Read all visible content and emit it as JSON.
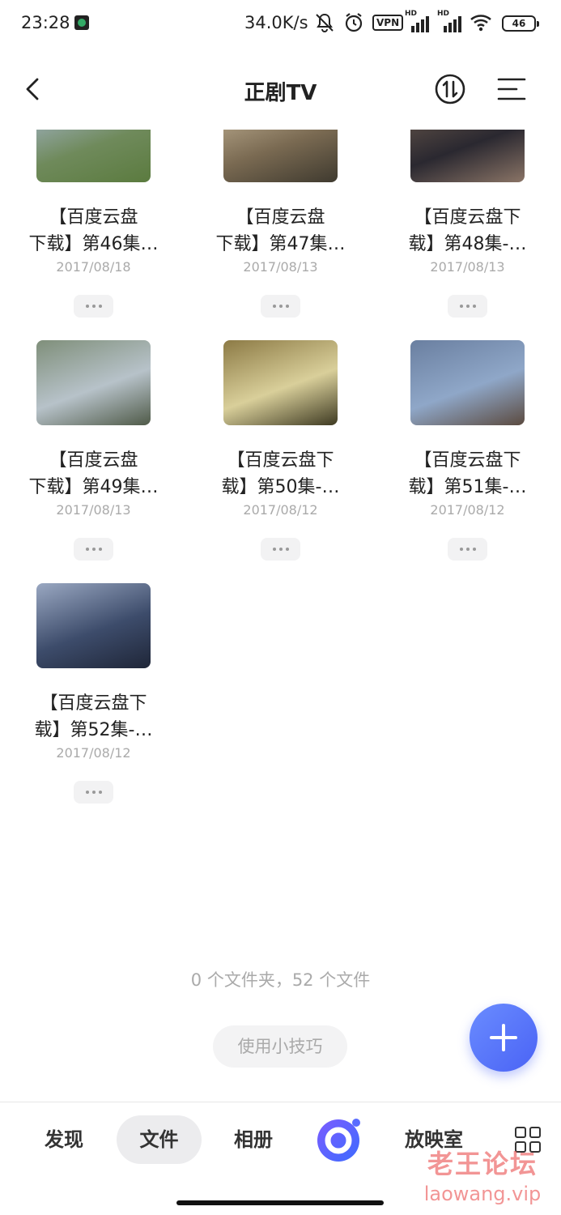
{
  "status_bar": {
    "time": "23:28",
    "net_speed": "34.0K/s",
    "vpn": "VPN",
    "hd": "HD",
    "battery": "46"
  },
  "header": {
    "title": "正剧TV",
    "back_icon": "chevron-left-icon",
    "sort_icon": "sort-icon",
    "menu_icon": "list-menu-icon"
  },
  "files": [
    {
      "line1": "【百度云盘",
      "line2": "下载】第46集…",
      "date": "2017/08/18",
      "thumb_colors": [
        "#6f8a5b",
        "#aab9d6",
        "#5b7b3f"
      ]
    },
    {
      "line1": "【百度云盘",
      "line2": "下载】第47集…",
      "date": "2017/08/13",
      "thumb_colors": [
        "#7a6a52",
        "#c7b79a",
        "#3f3a2f"
      ]
    },
    {
      "line1": "【百度云盘下",
      "line2": "载】第48集-…",
      "date": "2017/08/13",
      "thumb_colors": [
        "#2a2830",
        "#6d5b4d",
        "#8a7466"
      ]
    },
    {
      "line1": "【百度云盘",
      "line2": "下载】第49集…",
      "date": "2017/08/13",
      "thumb_colors": [
        "#b7c2c9",
        "#7f8f7a",
        "#4f5a48"
      ]
    },
    {
      "line1": "【百度云盘下",
      "line2": "载】第50集-…",
      "date": "2017/08/12",
      "thumb_colors": [
        "#d9cf9a",
        "#8c7a45",
        "#3e3a22"
      ]
    },
    {
      "line1": "【百度云盘下",
      "line2": "载】第51集-…",
      "date": "2017/08/12",
      "thumb_colors": [
        "#8fa7c8",
        "#6a7fa0",
        "#5b4a3f"
      ]
    },
    {
      "line1": "【百度云盘下",
      "line2": "载】第52集-…",
      "date": "2017/08/12",
      "thumb_colors": [
        "#3d4c6b",
        "#9aa8c2",
        "#1f2638"
      ]
    }
  ],
  "summary": "0 个文件夹，52 个文件",
  "tips_button": "使用小技巧",
  "fab": {
    "icon": "plus-icon"
  },
  "bottom_nav": {
    "items": [
      "发现",
      "文件",
      "相册",
      "放映室"
    ],
    "active": "文件",
    "center_icon": "ai-assistant-icon",
    "grid_icon": "apps-grid-icon"
  },
  "watermark": {
    "line1": "老王论坛",
    "line2": "laowang.vip"
  },
  "colors": {
    "accent": "#4a63f5",
    "text": "#222222",
    "muted": "#aaaaaa"
  }
}
